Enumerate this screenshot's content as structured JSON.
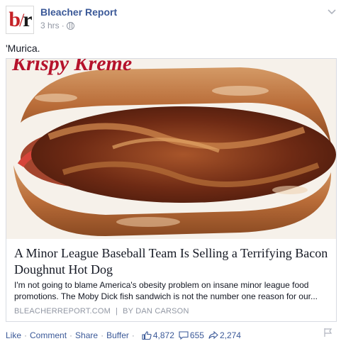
{
  "post": {
    "author": "Bleacher Report",
    "time": "3 hrs",
    "meta_sep": "·",
    "status_text": "'Murica.",
    "avatar": {
      "logo_b": "b",
      "logo_slash": "/",
      "logo_r": "r",
      "brand_color": "#c52126"
    }
  },
  "link_card": {
    "image_overlay_text": "Krispy Kreme",
    "title": "A Minor League Baseball Team Is Selling a Terrifying Bacon Doughnut Hot Dog",
    "description": "I'm not going to blame America's obesity problem on insane minor league food promotions. The Moby Dick fish sandwich is not the number one reason for our...",
    "source_domain": "BLEACHERREPORT.COM",
    "source_sep": "|",
    "source_author": "BY DAN CARSON"
  },
  "actions": {
    "like": "Like",
    "comment": "Comment",
    "share": "Share",
    "buffer": "Buffer",
    "sep": "·",
    "like_count": "4,872",
    "comment_count": "655",
    "share_count": "2,274"
  },
  "colors": {
    "link": "#3b5998",
    "muted": "#9197a3",
    "text": "#141823"
  }
}
